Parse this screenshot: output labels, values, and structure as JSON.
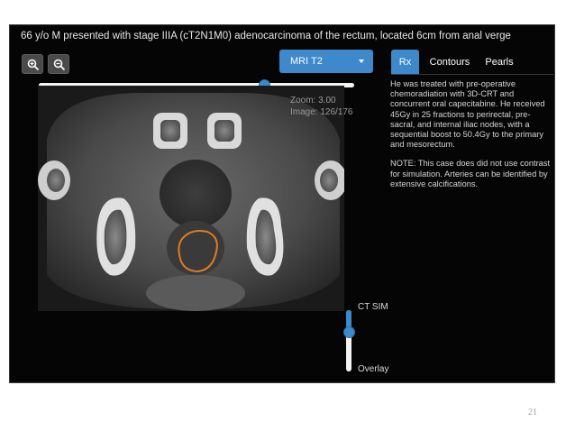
{
  "case": {
    "title": "66 y/o M presented with stage IIIA (cT2N1M0) adenocarcinoma of the rectum, located 6cm from anal verge"
  },
  "toolbar": {
    "zoom_in_icon": "zoom-in-icon",
    "zoom_out_icon": "zoom-out-icon",
    "series_select": {
      "selected": "MRI T2"
    }
  },
  "viewer": {
    "zoom_label": "Zoom: 3.00",
    "image_label": "Image: 126/176",
    "slice_slider": {
      "value": 126,
      "max": 176
    },
    "blend_slider": {
      "top_label": "CT SIM",
      "bottom_label": "Overlay",
      "fraction_from_top": 0.36
    },
    "contour_color": "#e07b22"
  },
  "tabs": [
    {
      "label": "Rx",
      "active": true
    },
    {
      "label": "Contours",
      "active": false
    },
    {
      "label": "Pearls",
      "active": false
    }
  ],
  "panel": {
    "paragraphs": [
      "He was treated with pre-operative chemoradiation with 3D-CRT and concurrent oral capecitabine. He received 45Gy in 25 fractions to perirectal, pre-sacral, and internal iliac nodes, with a sequential boost to 50.4Gy to the primary and mesorectum.",
      "NOTE: This case does did not use contrast for simulation. Arteries can be identified by extensive calcifications."
    ]
  },
  "footer": {
    "page_number": "21"
  },
  "colors": {
    "accent": "#3e88cc",
    "frame_background": "#050505"
  }
}
